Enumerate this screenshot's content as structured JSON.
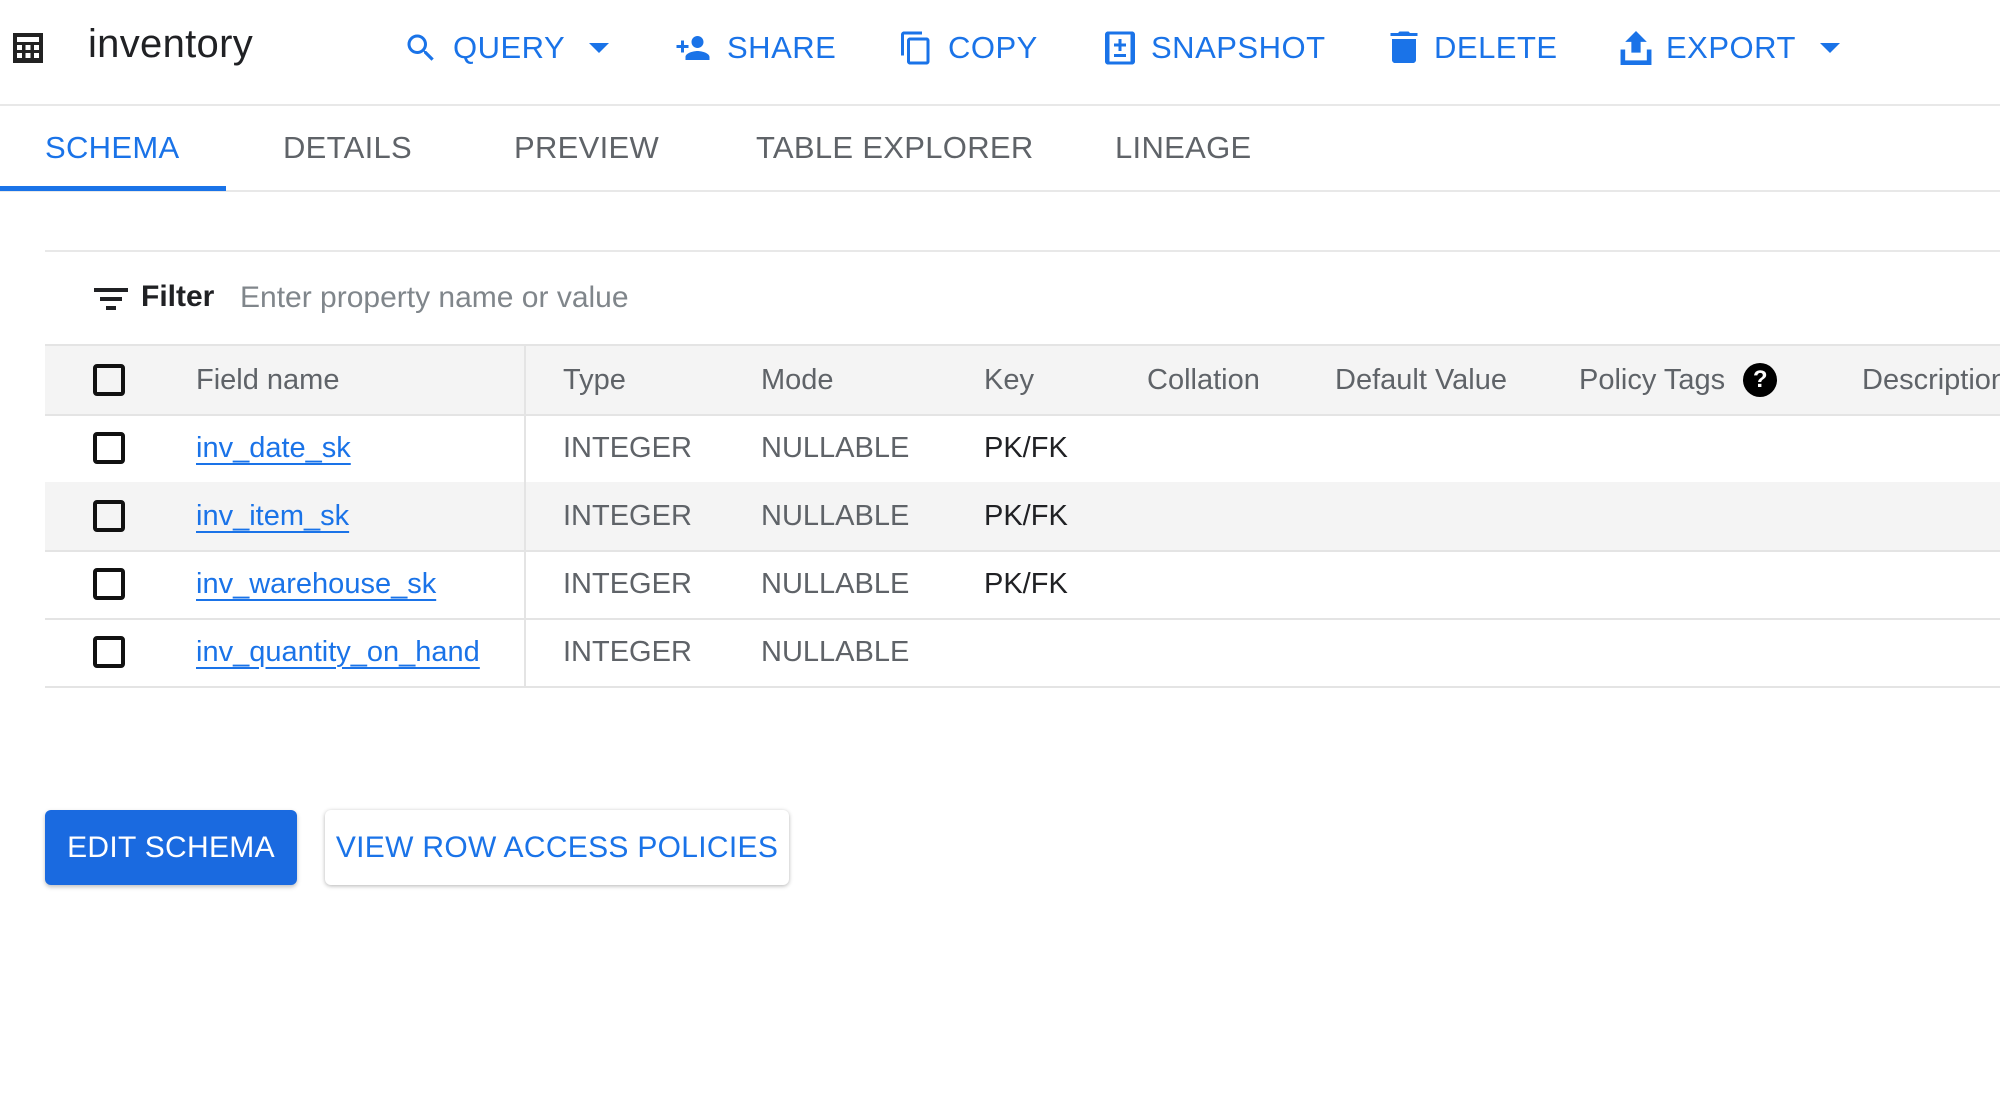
{
  "header": {
    "title": "inventory",
    "title_icon": "table-icon",
    "toolbar": [
      {
        "label": "QUERY",
        "icon": "search-icon",
        "has_dropdown": true
      },
      {
        "label": "SHARE",
        "icon": "person-add-icon",
        "has_dropdown": false
      },
      {
        "label": "COPY",
        "icon": "copy-icon",
        "has_dropdown": false
      },
      {
        "label": "SNAPSHOT",
        "icon": "snapshot-icon",
        "has_dropdown": false
      },
      {
        "label": "DELETE",
        "icon": "trash-icon",
        "has_dropdown": false
      },
      {
        "label": "EXPORT",
        "icon": "upload-icon",
        "has_dropdown": true
      }
    ]
  },
  "tabs": [
    {
      "label": "SCHEMA",
      "active": true
    },
    {
      "label": "DETAILS",
      "active": false
    },
    {
      "label": "PREVIEW",
      "active": false
    },
    {
      "label": "TABLE EXPLORER",
      "active": false
    },
    {
      "label": "LINEAGE",
      "active": false
    }
  ],
  "filter": {
    "label": "Filter",
    "value": "",
    "placeholder": "Enter property name or value"
  },
  "table": {
    "columns": [
      "Field name",
      "Type",
      "Mode",
      "Key",
      "Collation",
      "Default Value",
      "Policy Tags",
      "Description"
    ],
    "rows": [
      {
        "field_name": "inv_date_sk",
        "type": "INTEGER",
        "mode": "NULLABLE",
        "key": "PK/FK",
        "collation": "",
        "default_value": "",
        "policy_tags": "",
        "description": "",
        "checked": false
      },
      {
        "field_name": "inv_item_sk",
        "type": "INTEGER",
        "mode": "NULLABLE",
        "key": "PK/FK",
        "collation": "",
        "default_value": "",
        "policy_tags": "",
        "description": "",
        "checked": false
      },
      {
        "field_name": "inv_warehouse_sk",
        "type": "INTEGER",
        "mode": "NULLABLE",
        "key": "PK/FK",
        "collation": "",
        "default_value": "",
        "policy_tags": "",
        "description": "",
        "checked": false
      },
      {
        "field_name": "inv_quantity_on_hand",
        "type": "INTEGER",
        "mode": "NULLABLE",
        "key": "",
        "collation": "",
        "default_value": "",
        "policy_tags": "",
        "description": "",
        "checked": false
      }
    ],
    "help_icon_glyph": "?"
  },
  "actions": {
    "edit_schema": "EDIT SCHEMA",
    "view_row_access_policies": "VIEW ROW ACCESS POLICIES"
  },
  "colors": {
    "accent": "#1a73e8",
    "primary_button": "#1a6ae0",
    "header_bg": "#f4f4f4",
    "muted_text": "#5f6368"
  }
}
